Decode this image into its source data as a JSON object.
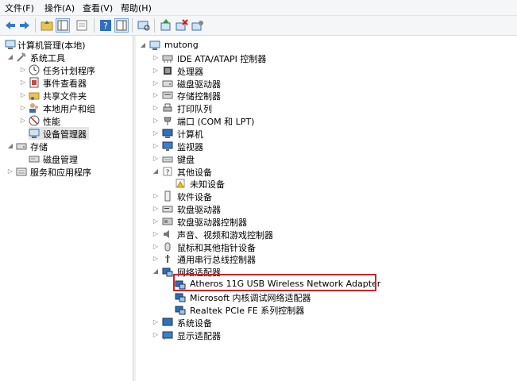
{
  "menu": {
    "file": "文件(F)",
    "action": "操作(A)",
    "view": "查看(V)",
    "help": "帮助(H)"
  },
  "left_tree": {
    "root": "计算机管理(本地)",
    "system_tools": "系统工具",
    "task_scheduler": "任务计划程序",
    "event_viewer": "事件查看器",
    "shared_folders": "共享文件夹",
    "local_users": "本地用户和组",
    "performance": "性能",
    "device_manager": "设备管理器",
    "storage": "存储",
    "disk_management": "磁盘管理",
    "services_apps": "服务和应用程序"
  },
  "device_tree": {
    "root": "mutong",
    "categories": [
      {
        "label": "IDE ATA/ATAPI 控制器",
        "icon": "ide-controller-icon"
      },
      {
        "label": "处理器",
        "icon": "processor-icon"
      },
      {
        "label": "磁盘驱动器",
        "icon": "disk-drive-icon"
      },
      {
        "label": "存储控制器",
        "icon": "storage-controller-icon"
      },
      {
        "label": "打印队列",
        "icon": "printer-icon"
      },
      {
        "label": "端口 (COM 和 LPT)",
        "icon": "port-icon"
      },
      {
        "label": "计算机",
        "icon": "computer-icon"
      },
      {
        "label": "监视器",
        "icon": "monitor-icon"
      },
      {
        "label": "键盘",
        "icon": "keyboard-icon"
      }
    ],
    "other_devices": "其他设备",
    "unknown_device": "未知设备",
    "categories2": [
      {
        "label": "软件设备",
        "icon": "software-device-icon"
      },
      {
        "label": "软盘驱动器",
        "icon": "floppy-drive-icon"
      },
      {
        "label": "软盘驱动器控制器",
        "icon": "floppy-controller-icon"
      },
      {
        "label": "声音、视频和游戏控制器",
        "icon": "sound-icon"
      },
      {
        "label": "鼠标和其他指针设备",
        "icon": "mouse-icon"
      },
      {
        "label": "通用串行总线控制器",
        "icon": "usb-icon"
      }
    ],
    "network_adapters": "网络适配器",
    "adapters": [
      "Atheros 11G USB Wireless Network Adapter",
      "Microsoft 内核调试网络适配器",
      "Realtek PCIe FE 系列控制器"
    ],
    "system_devices": "系统设备",
    "display_adapters": "显示适配器"
  },
  "colors": {
    "highlight_border": "#c8262c",
    "selection": "#e5e5e5"
  }
}
